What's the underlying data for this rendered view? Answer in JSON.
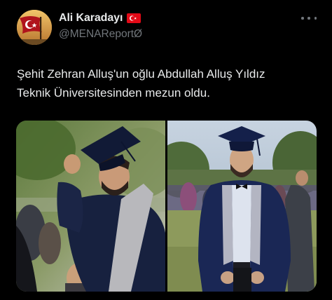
{
  "author": {
    "display_name": "Ali Karadayı",
    "handle": "@MENAReportØ",
    "badge_icon": "turkey-flag-icon",
    "avatar_icon": "turkish-flag-avatar"
  },
  "menu": {
    "icon": "more-dots-icon"
  },
  "tweet": {
    "text_line1": "Şehit Zehran Alluş'un oğlu Abdullah Alluş Yıldız",
    "text_line2": "Teknik Üniversitesinden mezun oldu."
  },
  "media": {
    "photos": [
      {
        "name": "graduate-tipping-cap-photo"
      },
      {
        "name": "graduate-posing-photo"
      }
    ]
  },
  "colors": {
    "background": "#000000",
    "text_primary": "#e7e9ea",
    "text_secondary": "#71767b",
    "flag_red": "#e30a17"
  }
}
